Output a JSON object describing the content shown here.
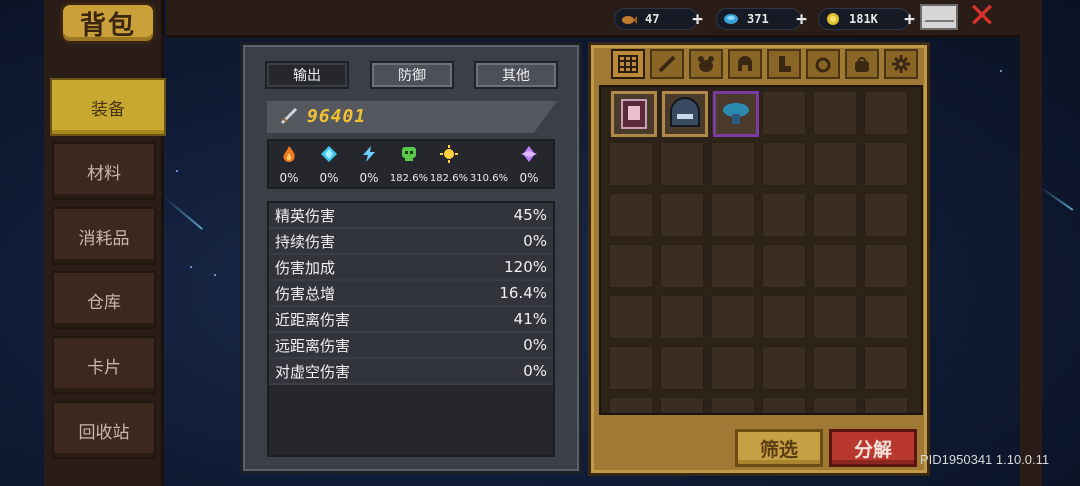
{
  "header": {
    "title": "背包"
  },
  "nav": [
    {
      "label": "装备",
      "active": true
    },
    {
      "label": "材料",
      "active": false
    },
    {
      "label": "消耗品",
      "active": false
    },
    {
      "label": "仓库",
      "active": false
    },
    {
      "label": "卡片",
      "active": false
    },
    {
      "label": "回收站",
      "active": false
    }
  ],
  "resources": [
    {
      "icon": "fish-icon",
      "value": "47",
      "color": "#c07a30"
    },
    {
      "icon": "gem-icon",
      "value": "371",
      "color": "#3aa0d8"
    },
    {
      "icon": "coin-icon",
      "value": "181K",
      "color": "#e0c030"
    }
  ],
  "stats": {
    "tabs": [
      "输出",
      "防御",
      "其他"
    ],
    "active_tab": 0,
    "power": "96401",
    "elements": [
      {
        "icon": "fire-icon",
        "value": "0%",
        "color": "#f07a22"
      },
      {
        "icon": "ice-icon",
        "value": "0%",
        "color": "#3ec8f0"
      },
      {
        "icon": "lightning-icon",
        "value": "0%",
        "color": "#6ad0ff"
      },
      {
        "icon": "poison-skull-icon",
        "value": "182.6%",
        "color": "#5ac84a"
      },
      {
        "icon": "sun-icon",
        "value": "182.6%",
        "color": "#ffd040"
      },
      {
        "icon": "crescent-icon",
        "value": "310.6%",
        "color": "#c8282e"
      },
      {
        "icon": "void-crystal-icon",
        "value": "0%",
        "color": "#c080ff"
      }
    ],
    "rows": [
      {
        "label": "精英伤害",
        "value": "45%"
      },
      {
        "label": "持续伤害",
        "value": "0%"
      },
      {
        "label": "伤害加成",
        "value": "120%"
      },
      {
        "label": "伤害总增",
        "value": "16.4%"
      },
      {
        "label": "近距离伤害",
        "value": "41%"
      },
      {
        "label": "远距离伤害",
        "value": "0%"
      },
      {
        "label": "对虚空伤害",
        "value": "0%"
      }
    ]
  },
  "inventory": {
    "category_icons": [
      "grid-icon",
      "sword-icon",
      "bear-icon",
      "helmet-icon",
      "boot-icon",
      "ring-icon",
      "bag-icon",
      "gear-icon"
    ],
    "items": [
      {
        "icon": "book-item-icon",
        "rarity_color": "#b0884a"
      },
      {
        "icon": "helmet-item-icon",
        "rarity_color": "#b0884a"
      },
      {
        "icon": "mushroom-item-icon",
        "rarity_color": "#7a3ca0"
      }
    ],
    "filter_label": "筛选",
    "decompose_label": "分解"
  },
  "footer": {
    "pid": "PID1950341 1.10.0.11"
  }
}
